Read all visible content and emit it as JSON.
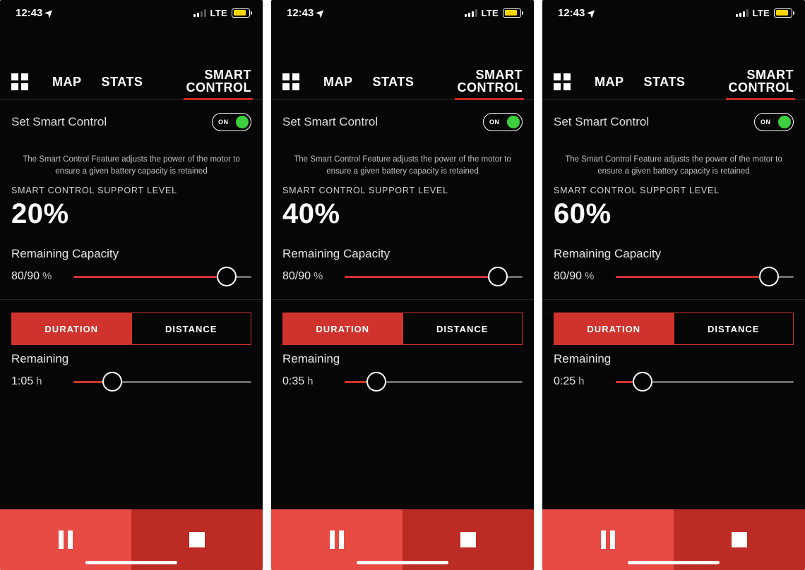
{
  "screens": [
    {
      "status": {
        "time": "12:43",
        "network": "LTE",
        "battery_pct": 78,
        "signal_bars": 2
      },
      "tabs": {
        "grid": true,
        "items": [
          "MAP",
          "STATS"
        ],
        "active_stack": [
          "SMART",
          "CONTROL"
        ]
      },
      "smart": {
        "title": "Set Smart Control",
        "toggle_label": "ON",
        "toggle_on": true,
        "desc": "The Smart Control Feature adjusts the power of the motor to ensure a given battery capacity is retained",
        "support_label": "SMART CONTROL SUPPORT LEVEL",
        "support_pct": "20%",
        "capacity_label": "Remaining Capacity",
        "capacity_value": "80/90",
        "capacity_unit": "%",
        "capacity_slider_pct": 86,
        "seg_duration": "DURATION",
        "seg_distance": "DISTANCE",
        "seg_active": "duration",
        "remaining_label": "Remaining",
        "remaining_value": "1:05",
        "remaining_unit": "h",
        "remaining_slider_pct": 22
      }
    },
    {
      "status": {
        "time": "12:43",
        "network": "LTE",
        "battery_pct": 78,
        "signal_bars": 3
      },
      "tabs": {
        "grid": true,
        "items": [
          "MAP",
          "STATS"
        ],
        "active_stack": [
          "SMART",
          "CONTROL"
        ]
      },
      "smart": {
        "title": "Set Smart Control",
        "toggle_label": "ON",
        "toggle_on": true,
        "desc": "The Smart Control Feature adjusts the power of the motor to ensure a given battery capacity is retained",
        "support_label": "SMART CONTROL SUPPORT LEVEL",
        "support_pct": "40%",
        "capacity_label": "Remaining Capacity",
        "capacity_value": "80/90",
        "capacity_unit": "%",
        "capacity_slider_pct": 86,
        "seg_duration": "DURATION",
        "seg_distance": "DISTANCE",
        "seg_active": "duration",
        "remaining_label": "Remaining",
        "remaining_value": "0:35",
        "remaining_unit": "h",
        "remaining_slider_pct": 18
      }
    },
    {
      "status": {
        "time": "12:43",
        "network": "LTE",
        "battery_pct": 78,
        "signal_bars": 3
      },
      "tabs": {
        "grid": true,
        "items": [
          "MAP",
          "STATS"
        ],
        "active_stack": [
          "SMART",
          "CONTROL"
        ]
      },
      "smart": {
        "title": "Set Smart Control",
        "toggle_label": "ON",
        "toggle_on": true,
        "desc": "The Smart Control Feature adjusts the power of the motor to ensure a given battery capacity is retained",
        "support_label": "SMART CONTROL SUPPORT LEVEL",
        "support_pct": "60%",
        "capacity_label": "Remaining Capacity",
        "capacity_value": "80/90",
        "capacity_unit": "%",
        "capacity_slider_pct": 86,
        "seg_duration": "DURATION",
        "seg_distance": "DISTANCE",
        "seg_active": "duration",
        "remaining_label": "Remaining",
        "remaining_value": "0:25",
        "remaining_unit": "h",
        "remaining_slider_pct": 15
      }
    }
  ]
}
